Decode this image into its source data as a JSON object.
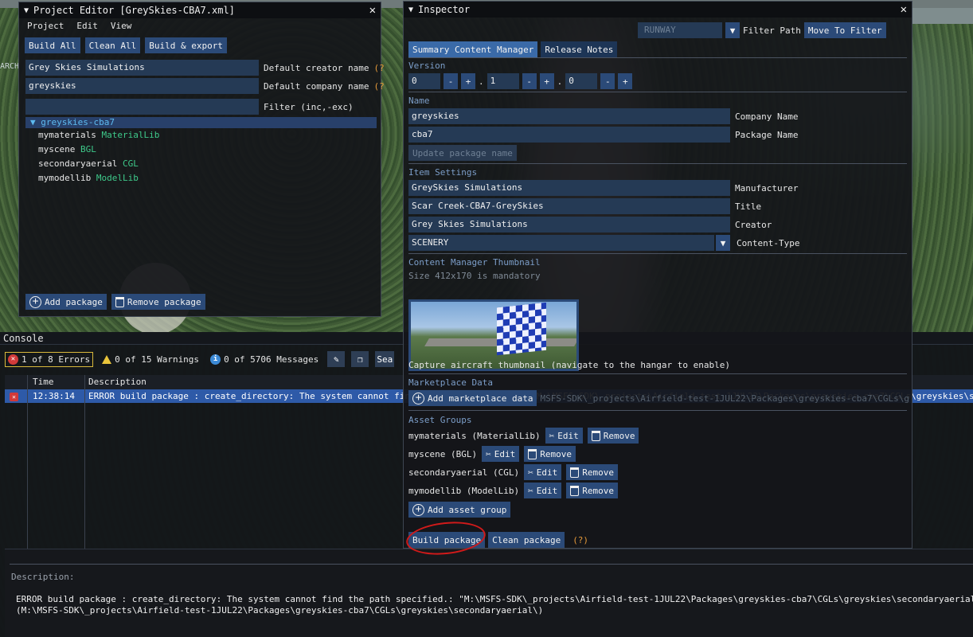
{
  "background": {
    "search_fragment": "ARCH",
    "runway_label": "RUNWAY"
  },
  "project_editor": {
    "title": "Project Editor [GreySkies-CBA7.xml]",
    "menu": [
      "Project",
      "Edit",
      "View"
    ],
    "toolbar": [
      "Build All",
      "Clean All",
      "Build & export"
    ],
    "creator_value": "Grey Skies Simulations",
    "creator_label": "Default creator name",
    "company_value": "greyskies",
    "company_label": "Default company name",
    "filter_value": "",
    "filter_label": "Filter (inc,-exc)",
    "help_marker": "(?",
    "tree_root": "greyskies-cba7",
    "tree_items": [
      {
        "name": "mymaterials",
        "type": "MaterialLib"
      },
      {
        "name": "myscene",
        "type": "BGL"
      },
      {
        "name": "secondaryaerial",
        "type": "CGL"
      },
      {
        "name": "mymodellib",
        "type": "ModelLib"
      }
    ],
    "add_package": "Add package",
    "remove_package": "Remove package"
  },
  "console": {
    "title": "Console",
    "errors": "1 of 8 Errors",
    "warnings": "0 of 15 Warnings",
    "messages": "0 of 5706 Messages",
    "search_fragment": "Sea",
    "col_time": "Time",
    "col_description": "Description",
    "rows": [
      {
        "time": "12:38:14",
        "description": "ERROR build package : create_directory: The system cannot find the path specified.: \"M:\\MSFS-SDK\\_projects\\Airfield-test-1JUL22\\Packages\\greyskies-cba7\\CGLs\\greyskies\\secondaryaerial\\\""
      }
    ],
    "desc_label": "Description:",
    "desc_text_line1": "ERROR build package : create_directory: The system cannot find the path specified.: \"M:\\MSFS-SDK\\_projects\\Airfield-test-1JUL22\\Packages\\greyskies-cba7\\CGLs\\greyskies\\secondaryaerial\\\"",
    "desc_text_line2": "(M:\\MSFS-SDK\\_projects\\Airfield-test-1JUL22\\Packages\\greyskies-cba7\\CGLs\\greyskies\\secondaryaerial\\)"
  },
  "inspector": {
    "title": "Inspector",
    "filter_path": "Filter Path",
    "move_to_filter": "Move To Filter",
    "tabs": [
      "Summary Content Manager",
      "Release Notes"
    ],
    "version_label": "Version",
    "version": [
      "0",
      "1",
      "0"
    ],
    "minus": "-",
    "plus": "+",
    "dot": ".",
    "name_label": "Name",
    "company_value": "greyskies",
    "company_label": "Company Name",
    "package_value": "cba7",
    "package_label": "Package Name",
    "update_package_name": "Update package name",
    "item_settings_label": "Item Settings",
    "manufacturer_value": "GreySkies Simulations",
    "manufacturer_label": "Manufacturer",
    "title_value": "Scar Creek-CBA7-GreySkies",
    "title_label": "Title",
    "creator_value": "Grey Skies Simulations",
    "creator_label": "Creator",
    "content_type_value": "SCENERY",
    "content_type_label": "Content-Type",
    "thumbnail_label": "Content Manager Thumbnail",
    "thumbnail_size": "Size 412x170 is mandatory",
    "capture_text": "Capture aircraft thumbnail (navigate to the hangar to enable)",
    "marketplace_label": "Marketplace Data",
    "add_marketplace": "Add marketplace data",
    "marketplace_path": "MSFS-SDK\\_projects\\Airfield-test-1JUL22\\Packages\\greyskies-cba7\\CGLs\\greyskies\\secondaryaerial",
    "asset_groups_label": "Asset Groups",
    "asset_groups": [
      {
        "label": "mymaterials (MaterialLib)"
      },
      {
        "label": "myscene (BGL)"
      },
      {
        "label": "secondaryaerial (CGL)"
      },
      {
        "label": "mymodellib (ModelLib)"
      }
    ],
    "edit": "Edit",
    "remove": "Remove",
    "add_asset_group": "Add asset group",
    "build_package": "Build package",
    "clean_package": "Clean package",
    "help": "(?)"
  },
  "colors": {
    "button": "#2b4a78",
    "section": "#7c9ec9",
    "accent_green": "#3ec98a",
    "error_red": "#d23a3a",
    "selected_row": "#2e5aa8",
    "annotation_circle": "#d11a1a"
  }
}
